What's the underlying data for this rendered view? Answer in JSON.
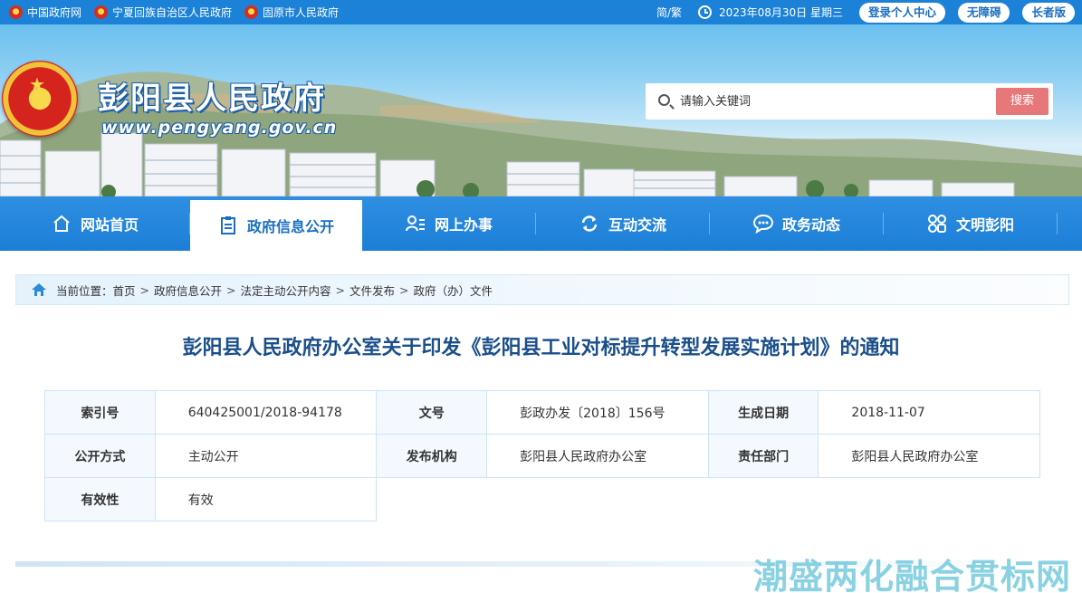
{
  "topbar": {
    "links": [
      {
        "label": "中国政府网"
      },
      {
        "label": "宁夏回族自治区人民政府"
      },
      {
        "label": "固原市人民政府"
      }
    ],
    "lang_toggle": "简/繁",
    "date": "2023年08月30日 星期三",
    "buttons": [
      "登录个人中心",
      "无障碍",
      "长者版"
    ]
  },
  "banner": {
    "site_title": "彭阳县人民政府",
    "site_url": "www.pengyang.gov.cn",
    "search_placeholder": "请输入关键词",
    "search_button": "搜索"
  },
  "nav": {
    "items": [
      {
        "label": "网站首页",
        "icon": "home-icon"
      },
      {
        "label": "政府信息公开",
        "icon": "document-icon",
        "active": true
      },
      {
        "label": "网上办事",
        "icon": "user-list-icon"
      },
      {
        "label": "互动交流",
        "icon": "refresh-arrows-icon"
      },
      {
        "label": "政务动态",
        "icon": "chat-bubble-icon"
      },
      {
        "label": "文明彭阳",
        "icon": "grid-icon"
      }
    ]
  },
  "breadcrumb": {
    "prefix": "当前位置：",
    "items": [
      "首页",
      "政府信息公开",
      "法定主动公开内容",
      "文件发布",
      "政府（办）文件"
    ]
  },
  "article": {
    "title": "彭阳县人民政府办公室关于印发《彭阳县工业对标提升转型发展实施计划》的通知"
  },
  "info": {
    "rows": [
      [
        [
          "索引号",
          "640425001/2018-94178"
        ],
        [
          "文号",
          "彭政办发〔2018〕156号"
        ],
        [
          "生成日期",
          "2018-11-07"
        ]
      ],
      [
        [
          "公开方式",
          "主动公开"
        ],
        [
          "发布机构",
          "彭阳县人民政府办公室"
        ],
        [
          "责任部门",
          "彭阳县人民政府办公室"
        ]
      ],
      [
        [
          "有效性",
          "有效"
        ]
      ]
    ]
  },
  "watermark": "潮盛两化融合贯标网",
  "colors": {
    "primary": "#1b82d8",
    "title": "#1a4f8a",
    "search_button": "#e8777a"
  }
}
